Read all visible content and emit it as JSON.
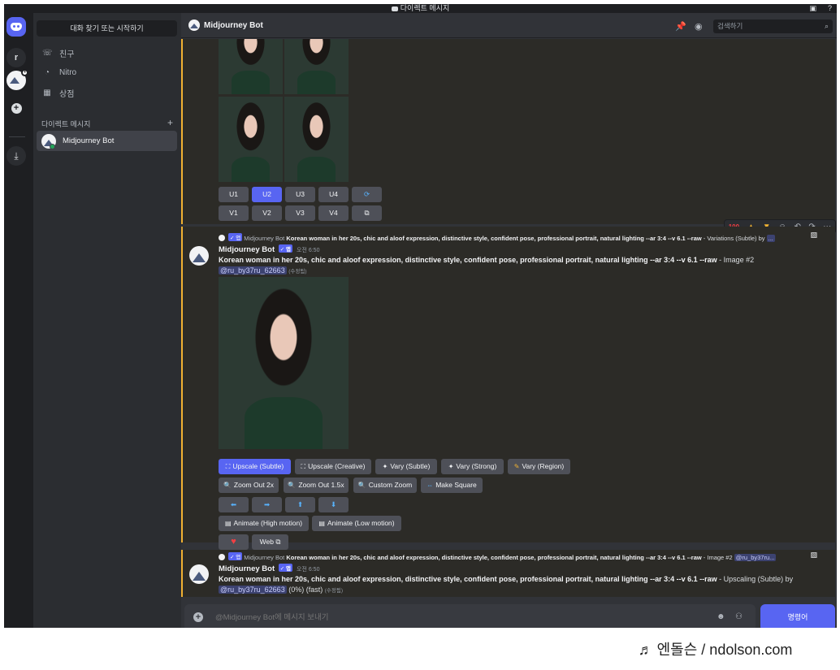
{
  "titlebar": {
    "title": "다이렉트 메시지"
  },
  "sidebar": {
    "search_placeholder": "대화 찾기 또는 시작하기",
    "nav": {
      "friends": "친구",
      "nitro": "Nitro",
      "shop": "상점"
    },
    "dm_header": "다이렉트 메시지",
    "dm_item": "Midjourney Bot",
    "server_initial": "r"
  },
  "header": {
    "title": "Midjourney Bot",
    "search_placeholder": "검색하기"
  },
  "msg1": {
    "upscale_buttons": [
      "U1",
      "U2",
      "U3",
      "U4"
    ],
    "variation_buttons": [
      "V1",
      "V2",
      "V3",
      "V4"
    ]
  },
  "msg2": {
    "ref_author": "Midjourney Bot",
    "ref_prompt": "Korean woman in her 20s, chic and aloof expression, distinctive style, confident pose, professional portrait, natural lighting --ar 3:4 --v 6.1 --raw",
    "ref_suffix": " - Variations (Subtle) by ",
    "ref_more": "...",
    "author": "Midjourney Bot",
    "app_tag": "✓ 앱",
    "time": "오전 6:50",
    "prompt": "Korean woman in her 20s, chic and aloof expression, distinctive style, confident pose, professional portrait, natural lighting --ar 3:4 --v 6.1 --raw",
    "suffix": " - Image #2",
    "mention": "@ru_by37ru_62663",
    "edited": "(수정됨)",
    "buttons_row1": [
      "Upscale (Subtle)",
      "Upscale (Creative)",
      "Vary (Subtle)",
      "Vary (Strong)",
      "Vary (Region)"
    ],
    "buttons_row2": [
      "Zoom Out 2x",
      "Zoom Out 1.5x",
      "Custom Zoom",
      "Make Square"
    ],
    "buttons_row4": [
      "Animate (High motion)",
      "Animate (Low motion)"
    ],
    "web_label": "Web"
  },
  "msg3": {
    "ref_author": "Midjourney Bot",
    "ref_prompt": "Korean woman in her 20s, chic and aloof expression, distinctive style, confident pose, professional portrait, natural lighting --ar 3:4 --v 6.1 --raw",
    "ref_suffix": " - Image #2 ",
    "ref_mention": "@ru_by37ru...",
    "author": "Midjourney Bot",
    "app_tag": "✓ 앱",
    "time": "오전 6:50",
    "prompt": "Korean woman in her 20s, chic and aloof expression, distinctive style, confident pose, professional portrait, natural lighting --ar 3:4 --v 6.1 --raw",
    "suffix": " - Upscaling (Subtle) by",
    "mention": "@ru_by37ru_62663",
    "progress": " (0%) (fast) ",
    "edited": "(수정됨)"
  },
  "composer": {
    "placeholder": "@Midjourney Bot에 메시지 보내기",
    "send_label": "명령어"
  },
  "watermark": "♬ 엔돌슨 / ndolson.com"
}
